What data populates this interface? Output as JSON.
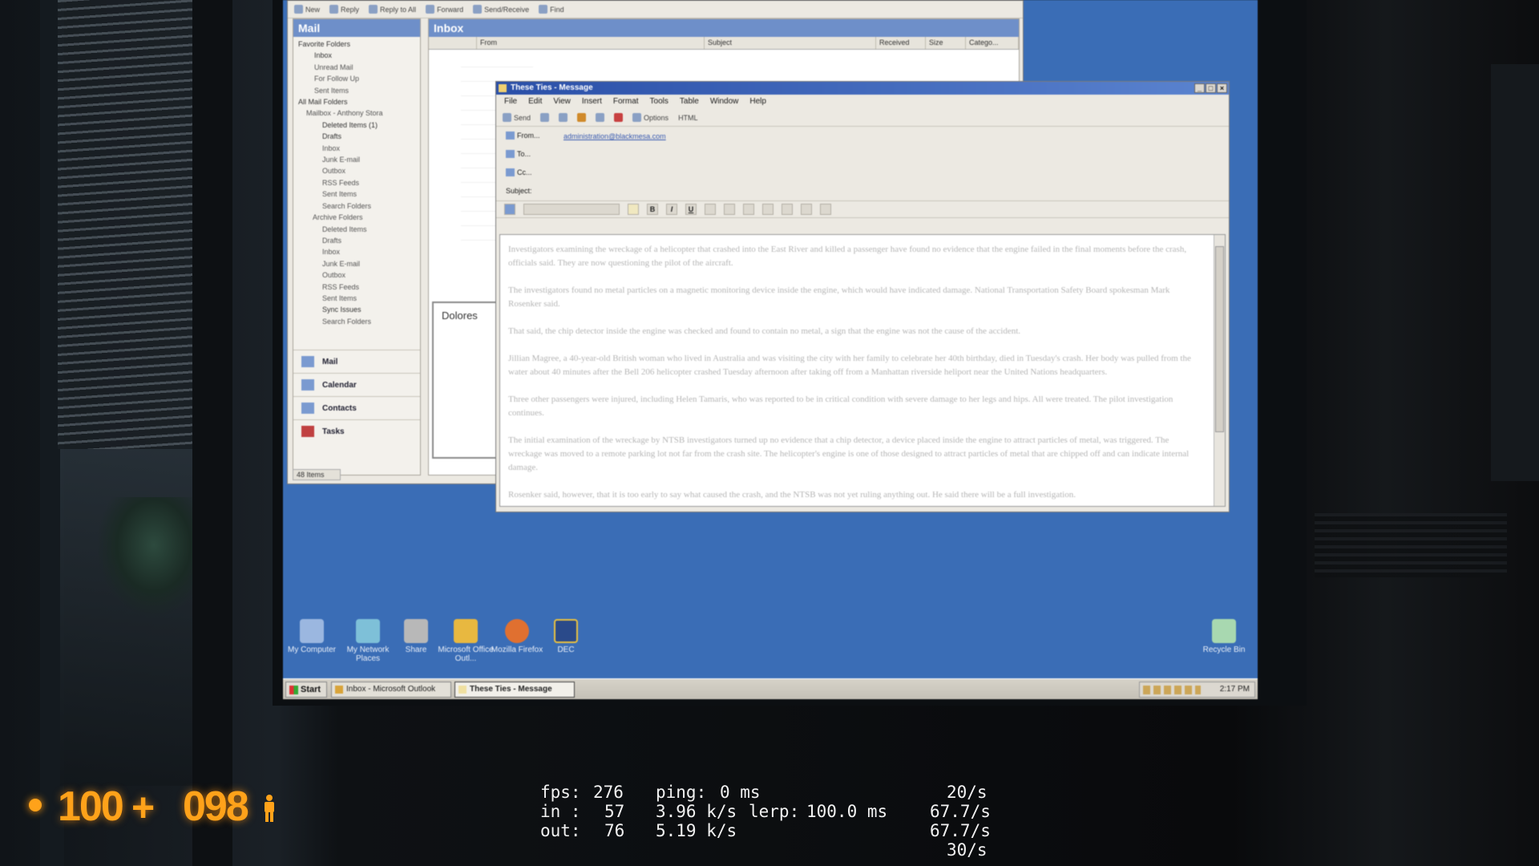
{
  "outlook": {
    "toolbar": [
      {
        "label": "New"
      },
      {
        "label": "Reply"
      },
      {
        "label": "Reply to All"
      },
      {
        "label": "Forward"
      },
      {
        "label": "Send/Receive"
      },
      {
        "label": "Find"
      }
    ],
    "mail_header": "Mail",
    "favorite_folders_label": "Favorite Folders",
    "favorite_folders": [
      "Inbox",
      "Unread Mail",
      "For Follow Up",
      "Sent Items"
    ],
    "all_mail_folders_label": "All Mail Folders",
    "mailbox_label": "Mailbox - Anthony Stora",
    "folder_tree": [
      "Deleted Items (1)",
      "Drafts",
      "Inbox",
      "Junk E-mail",
      "Outbox",
      "RSS Feeds",
      "Sent Items",
      "Search Folders",
      "Archive Folders",
      "Deleted Items",
      "Drafts",
      "Inbox",
      "Junk E-mail",
      "Outbox",
      "RSS Feeds",
      "Sent Items",
      "Sync Issues",
      "Search Folders"
    ],
    "nav_buttons": [
      "Mail",
      "Calendar",
      "Contacts",
      "Tasks"
    ],
    "status_items": "48 Items",
    "inbox_header": "Inbox",
    "columns": [
      "From",
      "Subject",
      "Received",
      "Size",
      "Catego..."
    ],
    "reading_pane_title": "Dolores"
  },
  "message": {
    "title": "These Ties - Message",
    "menu": [
      "File",
      "Edit",
      "View",
      "Insert",
      "Format",
      "Tools",
      "Table",
      "Window",
      "Help"
    ],
    "toolbar_send": "Send",
    "toolbar_options": "Options",
    "toolbar_html": "HTML",
    "from_label": "From...",
    "from_value": "administration@blackmesa.com",
    "to_label": "To...",
    "cc_label": "Cc...",
    "subject_label": "Subject:",
    "format_bold": "B",
    "format_italic": "I",
    "format_underline": "U",
    "body_paragraphs": [
      "Investigators examining the wreckage of a helicopter that crashed into the East River and killed a passenger have found no evidence that the engine failed in the final moments before the crash, officials said. They are now questioning the pilot of the aircraft.",
      "The investigators found no metal particles on a magnetic monitoring device inside the engine, which would have indicated damage. National Transportation Safety Board spokesman Mark Rosenker said.",
      "That said, the chip detector inside the engine was checked and found to contain no metal, a sign that the engine was not the cause of the accident.",
      "Jillian Magree, a 40-year-old British woman who lived in Australia and was visiting the city with her family to celebrate her 40th birthday, died in Tuesday's crash. Her body was pulled from the water about 40 minutes after the Bell 206 helicopter crashed Tuesday afternoon after taking off from a Manhattan riverside heliport near the United Nations headquarters.",
      "Three other passengers were injured, including Helen Tamaris, who was reported to be in critical condition with severe damage to her legs and hips. All were treated. The pilot investigation continues.",
      "The initial examination of the wreckage by NTSB investigators turned up no evidence that a chip detector, a device placed inside the engine to attract particles of metal, was triggered. The wreckage was moved to a remote parking lot not far from the crash site. The helicopter's engine is one of those designed to attract particles of metal that are chipped off and can indicate internal damage.",
      "Rosenker said, however, that it is too early to say what caused the crash, and the NTSB was not yet ruling anything out. He said there will be a full investigation."
    ]
  },
  "desktop": {
    "icons": [
      "My Computer",
      "My Network Places",
      "Share",
      "Microsoft Office Outl...",
      "Mozilla Firefox",
      "DEC"
    ],
    "recycle_bin": "Recycle Bin"
  },
  "taskbar": {
    "start": "Start",
    "tasks": [
      "Inbox - Microsoft Outlook",
      "These Ties - Message"
    ],
    "clock": "2:17 PM"
  },
  "hud": {
    "health": "100",
    "health_plus": "+",
    "armor": "098",
    "net": {
      "fps_label": "fps:",
      "fps": "276",
      "ping_label": "ping:",
      "ping": "0 ms",
      "rate1": "20/s",
      "in_label": "in :",
      "in_val": "57",
      "in_rate": "3.96 k/s",
      "lerp_label": "lerp:",
      "lerp": "100.0 ms",
      "rate2": "67.7/s",
      "out_label": "out:",
      "out_val": "76",
      "out_rate": "5.19 k/s",
      "rate3": "67.7/s",
      "rate4": "30/s"
    }
  },
  "colors": {
    "desktop": "#3a6db6",
    "hud": "#ffa21a",
    "titlebar": "#2a4fa8"
  }
}
